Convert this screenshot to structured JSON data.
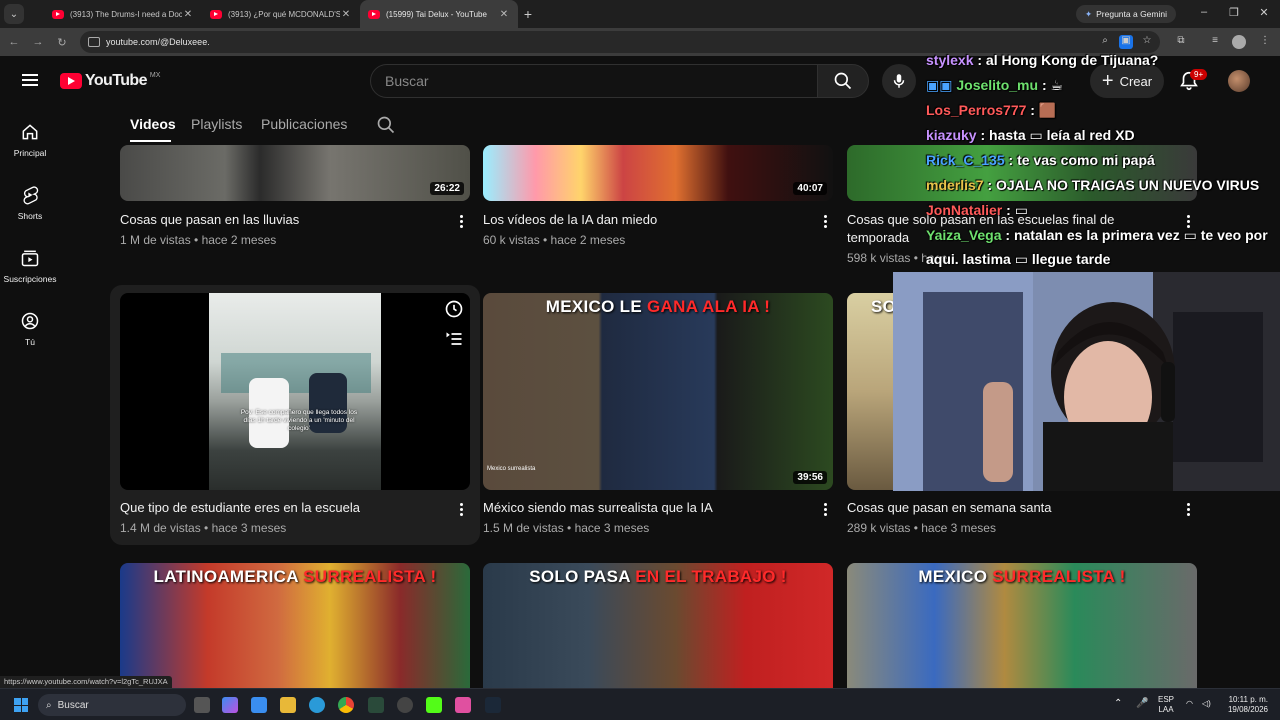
{
  "browser": {
    "tabs": [
      {
        "title": "(3913) The Drums-I need a Doc",
        "active": false
      },
      {
        "title": "(3913) ¿Por qué MCDONALD'S",
        "active": false
      },
      {
        "title": "(15999) Tai Delux - YouTube",
        "active": true
      }
    ],
    "gemini_label": "Pregunta a Gemini",
    "url": "youtube.com/@Deluxeee."
  },
  "youtube": {
    "logo_text": "YouTube",
    "region": "MX",
    "search_placeholder": "Buscar",
    "create_label": "Crear",
    "notifications_badge": "9+"
  },
  "sidebar": {
    "items": [
      {
        "label": "Principal",
        "icon": "home-icon"
      },
      {
        "label": "Shorts",
        "icon": "shorts-icon"
      },
      {
        "label": "Suscripciones",
        "icon": "subscriptions-icon"
      },
      {
        "label": "Tú",
        "icon": "you-icon"
      }
    ]
  },
  "channel_tabs": [
    "Videos",
    "Playlists",
    "Publicaciones"
  ],
  "videos": [
    {
      "title": "Cosas que pasan en las lluvias",
      "meta": "1 M de vistas • hace 2 meses",
      "duration": "26:22"
    },
    {
      "title": "Los vídeos de la IA dan miedo",
      "meta": "60 k vistas • hace 2 meses",
      "duration": "40:07"
    },
    {
      "title": "Cosas que solo pasan en las escuelas final de temporada",
      "title_line1": "Cosas que solo pasan en las escuelas final de",
      "title_line2": "temporada",
      "meta": "598 k vistas • hace",
      "duration": ""
    },
    {
      "title": "Que tipo de estudiante eres en la escuela",
      "meta": "1.4 M de vistas • hace 3 meses",
      "duration": "",
      "overlay_text": "Pov: Ese compañero que llega todos los días 1h tarde viviendo a un 'minuto del colegio'"
    },
    {
      "title": "México siendo mas surrealista que la IA",
      "meta": "1.5 M de vistas • hace 3 meses",
      "duration": "39:56",
      "banner_white": "MEXICO LE ",
      "banner_red": "GANA ALA IA !",
      "credit": "Mexico surrealista"
    },
    {
      "title": "Cosas que pasan en semana santa",
      "meta": "289 k vistas • hace 3 meses",
      "duration": "",
      "banner_white": "SO"
    },
    {
      "banner_white": "LATINOAMERICA ",
      "banner_red": "SURREALISTA !"
    },
    {
      "banner_white": "SOLO PASA ",
      "banner_red": "EN EL TRABAJO !"
    },
    {
      "banner_white": "MEXICO ",
      "banner_red": "SURREALISTA !"
    }
  ],
  "chat": [
    {
      "user": "stylexk",
      "text": ": al Hong Kong de Tijuana?",
      "color": "#c792ff"
    },
    {
      "user": "Joselito_mu",
      "text": ":",
      "color": "#6ee06e"
    },
    {
      "user": "Los_Perros777",
      "text": ":",
      "color": "#ff5a5a"
    },
    {
      "user": "kiazuky",
      "text": ": hasta",
      "text2": "leía al red XD",
      "color": "#c792ff"
    },
    {
      "user": "Rick_C_135",
      "text": ": te vas como mi papá",
      "color": "#4aa3ff"
    },
    {
      "user": "mderlis7",
      "text": ": OJALA NO TRAIGAS UN NUEVO VIRUS",
      "color": "#e8c34a"
    },
    {
      "user": "JonNatalier",
      "text": ":",
      "color": "#ff5a5a"
    },
    {
      "user": "Yaiza_Vega",
      "text": ": natalan es la primera vez",
      "text2": "te veo por",
      "color": "#6ee06e"
    },
    {
      "user": "",
      "text": "aqui. lastima",
      "text2": "llegue tarde",
      "color": "#ffffff"
    }
  ],
  "status_url": "https://www.youtube.com/watch?v=l2gTc_RUJXA",
  "taskbar": {
    "search_label": "Buscar",
    "lang_top": "ESP",
    "lang_bottom": "LAA",
    "time": "10:11 p. m.",
    "date": "19/08/2026"
  }
}
